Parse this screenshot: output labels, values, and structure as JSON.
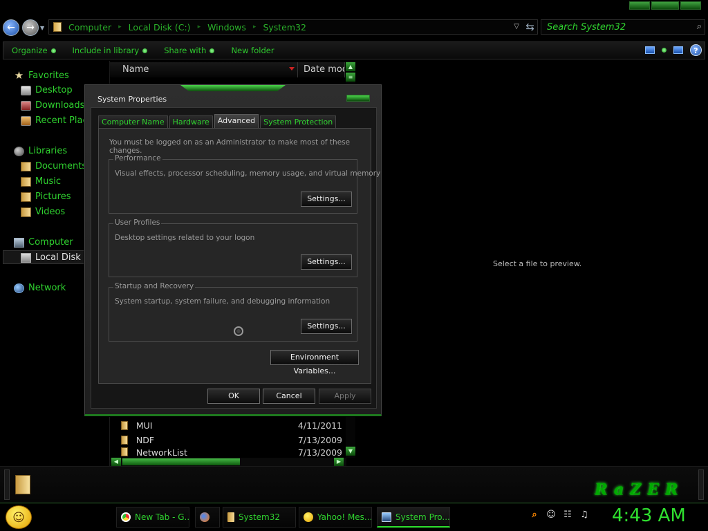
{
  "explorer": {
    "address": {
      "crumbs": [
        "Computer",
        "Local Disk (C:)",
        "Windows",
        "System32"
      ]
    },
    "search": {
      "placeholder": "Search System32"
    },
    "toolbar": {
      "organize": "Organize",
      "include_in_library": "Include in library",
      "share_with": "Share with",
      "new_folder": "New folder"
    },
    "nav": {
      "favorites": "Favorites",
      "desktop": "Desktop",
      "downloads": "Downloads",
      "recent_places": "Recent Plac",
      "libraries": "Libraries",
      "documents": "Documents",
      "music": "Music",
      "pictures": "Pictures",
      "videos": "Videos",
      "computer": "Computer",
      "local_disk": "Local Disk (C:)",
      "network": "Network"
    },
    "columns": {
      "name": "Name",
      "date": "Date modi"
    },
    "files": [
      {
        "name": "MUI",
        "date": "4/11/2011"
      },
      {
        "name": "NDF",
        "date": "7/13/2009"
      },
      {
        "name": "NetworkList",
        "date": "7/13/2009"
      }
    ],
    "preview_text": "Select a file to preview.",
    "brand": "RaZER"
  },
  "dialog": {
    "title": "System Properties",
    "tabs": [
      "Computer Name",
      "Hardware",
      "Advanced",
      "System Protection"
    ],
    "active_tab": "Advanced",
    "admin_message": "You must be logged on as an Administrator to make most of these changes.",
    "performance": {
      "label": "Performance",
      "description": "Visual effects, processor scheduling, memory usage, and virtual memory",
      "button": "Settings..."
    },
    "user_profiles": {
      "label": "User Profiles",
      "description": "Desktop settings related to your logon",
      "button": "Settings..."
    },
    "startup_recovery": {
      "label": "Startup and Recovery",
      "description": "System startup, system failure, and debugging information",
      "button": "Settings..."
    },
    "env_button": "Environment Variables...",
    "ok": "OK",
    "cancel": "Cancel",
    "apply": "Apply"
  },
  "taskbar": {
    "buttons": [
      {
        "label": "New Tab - G..."
      },
      {
        "label": ""
      },
      {
        "label": "System32"
      },
      {
        "label": "Yahoo! Mes..."
      },
      {
        "label": "System Pro..."
      }
    ],
    "clock": "4:43 AM"
  },
  "colors": {
    "accent_green": "#2fd12f",
    "background": "#000000",
    "dialog_bg": "#262626"
  }
}
